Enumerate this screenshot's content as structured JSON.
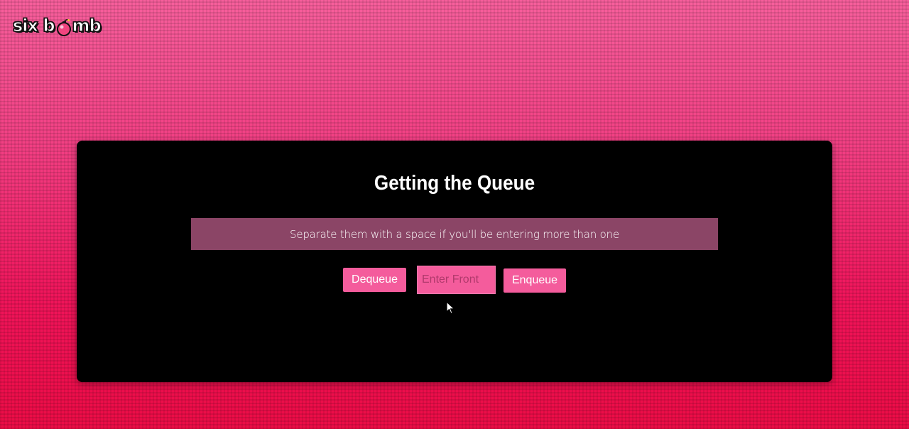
{
  "logo": {
    "part1": "six b",
    "part2": "mb",
    "icon": "bomb-icon"
  },
  "panel": {
    "title": "Getting the Queue",
    "hint": "Separate them with a space if you'll be entering more than one"
  },
  "controls": {
    "dequeue_label": "Dequeue",
    "input_placeholder": "Enter Front",
    "input_value": "",
    "enqueue_label": "Enqueue"
  },
  "colors": {
    "background_top": "#f75f9c",
    "background_bottom": "#ec0c46",
    "panel": "#000000",
    "hint_bar": "#8b4566",
    "button": "#f45c9c",
    "text": "#ffffff"
  }
}
